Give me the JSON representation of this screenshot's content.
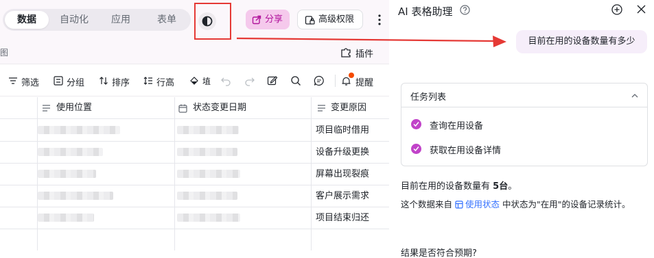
{
  "topbar": {
    "tabs": [
      {
        "label": "数据",
        "active": true
      },
      {
        "label": "自动化",
        "active": false
      },
      {
        "label": "应用",
        "active": false
      },
      {
        "label": "表单",
        "active": false
      }
    ],
    "share_label": "分享",
    "permission_label": "高级权限"
  },
  "subbar": {
    "view_fragment": "图",
    "plugin_label": "插件"
  },
  "toolbar": {
    "filter_label": "筛选",
    "group_label": "分组",
    "sort_label": "排序",
    "row_height_label": "行高",
    "fill_fragment": "埴",
    "reminder_label": "提醒"
  },
  "grid": {
    "columns": [
      {
        "label": "使用位置",
        "icon": "text-field-icon"
      },
      {
        "label": "状态变更日期",
        "icon": "calendar-icon"
      },
      {
        "label": "变更原因",
        "icon": "text-field-icon"
      }
    ],
    "rows": [
      {
        "reason": "项目临时借用"
      },
      {
        "reason": "设备升级更换"
      },
      {
        "reason": "屏幕出现裂痕"
      },
      {
        "reason": "客户展示需求"
      },
      {
        "reason": "项目结束归还"
      }
    ]
  },
  "assistant": {
    "title": "AI 表格助理",
    "user_question": "目前在用的设备数量有多少",
    "task_list_title": "任务列表",
    "tasks": [
      {
        "label": "查询在用设备",
        "done": true
      },
      {
        "label": "获取在用设备详情",
        "done": true
      }
    ],
    "answer_prefix": "目前在用的设备数量有",
    "answer_count": "5台",
    "answer_suffix": "。",
    "source_prefix": "这个数据来自",
    "source_table": "使用状态",
    "source_suffix": "中状态为\"在用\"的设备记录统计。",
    "followup": "结果是否符合预期?"
  },
  "colors": {
    "accent": "#c143c9",
    "share_bg": "#f5c9ec",
    "share_text": "#b1149c",
    "link": "#3370ff",
    "highlight": "#e53935"
  }
}
